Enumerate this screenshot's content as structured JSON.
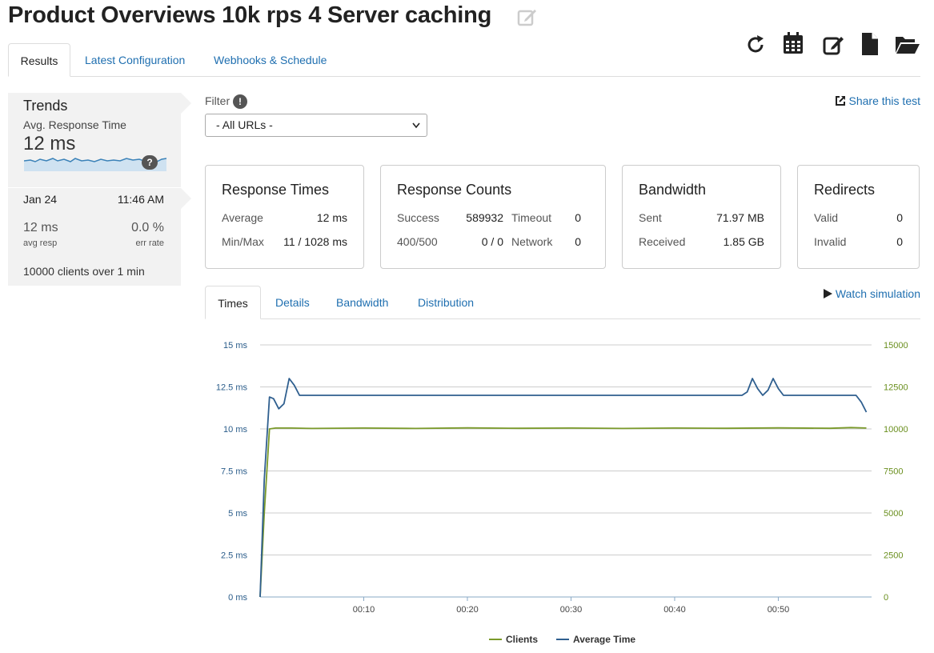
{
  "page": {
    "title": "Product Overviews 10k rps 4 Server caching"
  },
  "toolbar": {
    "icons": [
      "refresh-icon",
      "calendar-icon",
      "edit-icon",
      "file-icon",
      "folder-open-icon"
    ]
  },
  "tabs": [
    {
      "label": "Results",
      "active": true
    },
    {
      "label": "Latest Configuration",
      "active": false
    },
    {
      "label": "Webhooks & Schedule",
      "active": false
    }
  ],
  "trends": {
    "title": "Trends",
    "subtitle": "Avg. Response Time",
    "value": "12 ms",
    "help": "?",
    "date": "Jan 24",
    "time": "11:46 AM",
    "avg_resp_value": "12 ms",
    "avg_resp_label": "avg resp",
    "err_rate_value": "0.0 %",
    "err_rate_label": "err rate",
    "clients_count": "10000",
    "clients_text": "clients over",
    "duration": "1",
    "duration_unit": "min"
  },
  "filter": {
    "label": "Filter",
    "info": "!",
    "selected": "- All URLs -"
  },
  "share": {
    "label": "Share this test"
  },
  "cards": {
    "response_times": {
      "title": "Response Times",
      "average_label": "Average",
      "average_value": "12 ms",
      "minmax_label": "Min/Max",
      "minmax_value": "11 / 1028 ms"
    },
    "response_counts": {
      "title": "Response Counts",
      "success_label": "Success",
      "success_value": "589932",
      "timeout_label": "Timeout",
      "timeout_value": "0",
      "err_label": "400/500",
      "err_value": "0 / 0",
      "network_label": "Network",
      "network_value": "0"
    },
    "bandwidth": {
      "title": "Bandwidth",
      "sent_label": "Sent",
      "sent_value": "71.97 MB",
      "received_label": "Received",
      "received_value": "1.85 GB"
    },
    "redirects": {
      "title": "Redirects",
      "valid_label": "Valid",
      "valid_value": "0",
      "invalid_label": "Invalid",
      "invalid_value": "0"
    }
  },
  "sub_tabs": [
    {
      "label": "Times",
      "active": true
    },
    {
      "label": "Details",
      "active": false
    },
    {
      "label": "Bandwidth",
      "active": false
    },
    {
      "label": "Distribution",
      "active": false
    }
  ],
  "watch": {
    "label": "Watch simulation"
  },
  "chart_data": {
    "type": "line",
    "yleft_ticks": [
      "0 ms",
      "2.5 ms",
      "5 ms",
      "7.5 ms",
      "10 ms",
      "12.5 ms",
      "15 ms"
    ],
    "yright_ticks": [
      "0",
      "2500",
      "5000",
      "7500",
      "10000",
      "12500",
      "15000"
    ],
    "x_ticks": [
      "00:10",
      "00:20",
      "00:30",
      "00:40",
      "00:50"
    ],
    "x_tick_seconds": [
      10,
      20,
      30,
      40,
      50
    ],
    "xlim": [
      0,
      59
    ],
    "yleft_lim": [
      0,
      15
    ],
    "yright_lim": [
      0,
      15000
    ],
    "series": [
      {
        "name": "Clients",
        "axis": "right",
        "color": "#7a9a2a",
        "x": [
          0,
          0.4,
          0.9,
          1.5,
          3,
          5,
          10,
          15,
          20,
          25,
          30,
          35,
          40,
          45,
          50,
          55,
          57,
          58.5
        ],
        "values": [
          0,
          5000,
          10000,
          10050,
          10050,
          10030,
          10050,
          10030,
          10060,
          10040,
          10050,
          10030,
          10050,
          10040,
          10060,
          10040,
          10080,
          10050
        ]
      },
      {
        "name": "Average Time",
        "axis": "left",
        "color": "#2f5f8f",
        "x": [
          0,
          0.4,
          0.9,
          1.3,
          1.8,
          2.3,
          2.8,
          3.3,
          3.8,
          4.5,
          10,
          20,
          30,
          40,
          46.5,
          47,
          47.5,
          48,
          48.5,
          49,
          49.5,
          50,
          50.5,
          51,
          55,
          57.5,
          58,
          58.5
        ],
        "values": [
          0,
          7,
          11.9,
          11.8,
          11.2,
          11.5,
          13,
          12.6,
          12,
          12,
          12,
          12,
          12,
          12,
          12,
          12.2,
          13,
          12.4,
          12,
          12.3,
          13,
          12.4,
          12,
          12,
          12,
          12,
          11.6,
          11
        ]
      }
    ],
    "legend": "bottom-center"
  }
}
